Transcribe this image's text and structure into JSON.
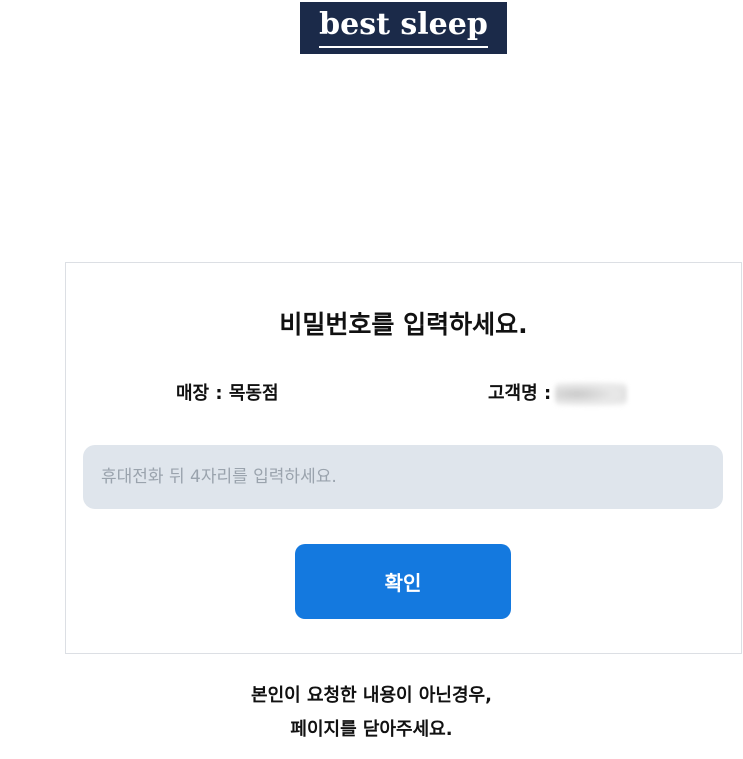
{
  "logo": {
    "text": "best sleep",
    "background_color": "#1b2a49"
  },
  "card": {
    "title": "비밀번호를 입력하세요.",
    "store_label": "매장 : 목동점",
    "customer_label": "고객명 :",
    "password_input": {
      "value": "",
      "placeholder": "휴대전화 뒤 4자리를 입력하세요."
    },
    "confirm_label": "확인",
    "accent_color": "#1479df"
  },
  "notice": {
    "line1": "본인이 요청한 내용이 아닌경우,",
    "line2": "페이지를 닫아주세요."
  }
}
